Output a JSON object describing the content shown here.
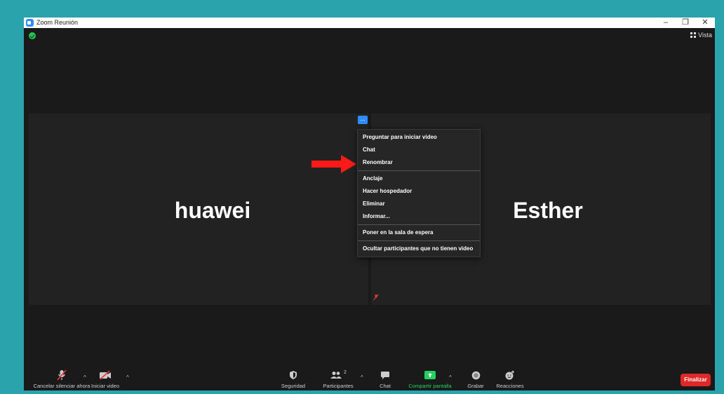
{
  "window": {
    "title": "Zoom Reunión",
    "minimize": "–",
    "maximize": "❐",
    "close": "✕"
  },
  "top_right": {
    "view_label": "Vista"
  },
  "participants": [
    {
      "name": "huawei"
    },
    {
      "name": "Esther"
    }
  ],
  "more_button": {
    "label": "..."
  },
  "context_menu": {
    "group1": [
      "Preguntar para iniciar video",
      "Chat",
      "Renombrar"
    ],
    "group2": [
      "Anclaje",
      "Hacer hospedador",
      "Eliminar",
      "Informar..."
    ],
    "group3": [
      "Poner en la sala de espera"
    ],
    "group4": [
      "Ocultar participantes que no tienen video"
    ]
  },
  "toolbar": {
    "mute_label": "Cancelar silenciar ahora",
    "video_label": "Iniciar video",
    "security_label": "Seguridad",
    "participants_label": "Participantes",
    "participants_count": "2",
    "chat_label": "Chat",
    "share_label": "Compartir pantalla",
    "record_label": "Grabar",
    "reactions_label": "Reacciones",
    "end_label": "Finalizar"
  },
  "colors": {
    "accent_blue": "#2d8cff",
    "share_green": "#23d160",
    "end_red": "#e02828",
    "annotation_arrow": "#ff1a1a",
    "frame_teal": "#2aa3ad"
  }
}
